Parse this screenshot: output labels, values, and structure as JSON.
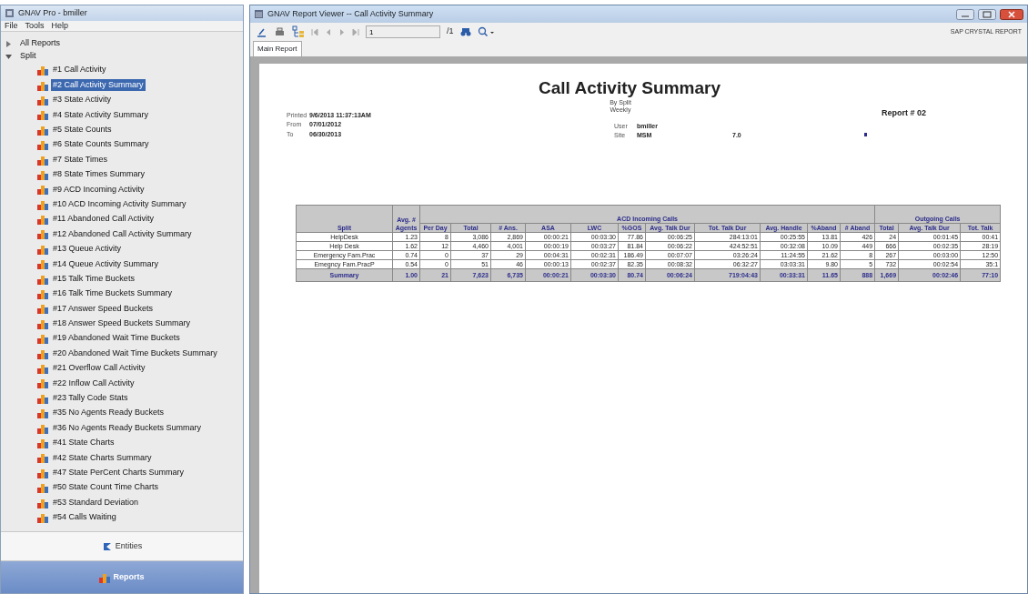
{
  "left_window": {
    "title": "GNAV Pro - bmiller",
    "menu": [
      "File",
      "Tools",
      "Help"
    ],
    "tree": [
      {
        "label": "All Reports",
        "expanded": false
      },
      {
        "label": "Split",
        "expanded": true,
        "children": [
          {
            "label": "#1 Call Activity",
            "selected": false
          },
          {
            "label": "#2 Call Activity Summary",
            "selected": true
          },
          {
            "label": "#3 State Activity",
            "selected": false
          },
          {
            "label": "#4 State Activity Summary",
            "selected": false
          },
          {
            "label": "#5 State Counts",
            "selected": false
          },
          {
            "label": "#6 State Counts Summary",
            "selected": false
          },
          {
            "label": "#7 State Times",
            "selected": false
          },
          {
            "label": "#8 State Times Summary",
            "selected": false
          },
          {
            "label": "#9 ACD Incoming Activity",
            "selected": false
          },
          {
            "label": "#10 ACD Incoming Activity Summary",
            "selected": false
          },
          {
            "label": "#11 Abandoned Call Activity",
            "selected": false
          },
          {
            "label": "#12 Abandoned Call Activity Summary",
            "selected": false
          },
          {
            "label": "#13 Queue Activity",
            "selected": false
          },
          {
            "label": "#14 Queue Activity Summary",
            "selected": false
          },
          {
            "label": "#15 Talk Time Buckets",
            "selected": false
          },
          {
            "label": "#16 Talk Time Buckets Summary",
            "selected": false
          },
          {
            "label": "#17 Answer Speed Buckets",
            "selected": false
          },
          {
            "label": "#18 Answer Speed Buckets Summary",
            "selected": false
          },
          {
            "label": "#19 Abandoned Wait Time Buckets",
            "selected": false
          },
          {
            "label": "#20 Abandoned Wait Time Buckets Summary",
            "selected": false
          },
          {
            "label": "#21 Overflow Call Activity",
            "selected": false
          },
          {
            "label": "#22 Inflow Call Activity",
            "selected": false
          },
          {
            "label": "#23 Tally Code Stats",
            "selected": false
          },
          {
            "label": "#35 No Agents Ready Buckets",
            "selected": false
          },
          {
            "label": "#36 No Agents Ready Buckets Summary",
            "selected": false
          },
          {
            "label": "#41 State Charts",
            "selected": false
          },
          {
            "label": "#42 State Charts Summary",
            "selected": false
          },
          {
            "label": "#47 State PerCent Charts Summary",
            "selected": false
          },
          {
            "label": "#50 State Count Time Charts",
            "selected": false
          },
          {
            "label": "#53 Standard Deviation",
            "selected": false
          },
          {
            "label": "#54 Calls Waiting",
            "selected": false
          }
        ]
      }
    ],
    "nav_buttons": [
      {
        "label": "Entities",
        "kind": "entities",
        "selected": false
      },
      {
        "label": "Reports",
        "kind": "reports",
        "selected": true
      }
    ]
  },
  "viewer": {
    "title": "GNAV Report Viewer -- Call Activity Summary",
    "page_field": "1",
    "page_count": "/1",
    "brand": "SAP CRYSTAL REPORT",
    "tabs": [
      {
        "label": "Main Report",
        "selected": true
      }
    ],
    "report": {
      "title": "Call Activity Summary",
      "subtitle": [
        "By Split",
        "Weekly"
      ],
      "report_number": "Report # 02",
      "left_fields": [
        {
          "label": "Printed",
          "value": "9/6/2013 11:37:13AM"
        },
        {
          "label": "From",
          "value": "07/01/2012"
        },
        {
          "label": "To",
          "value": "06/30/2013"
        }
      ],
      "right_fields": [
        {
          "label": "User",
          "value": "bmiller"
        },
        {
          "label": "Site",
          "value": "MSM",
          "extra": "7.0"
        }
      ],
      "table": {
        "columns": [
          "Split",
          "Avg. # Agents"
        ],
        "groups": [
          {
            "label": "ACD Incoming Calls",
            "columns": [
              "Per Day",
              "Total",
              "# Ans.",
              "ASA",
              "LWC",
              "%GOS",
              "Avg. Talk Dur",
              "Tot. Talk Dur",
              "Avg. Handle",
              "%Aband",
              "# Aband"
            ]
          },
          {
            "label": "Outgoing Calls",
            "columns": [
              "Total",
              "Avg. Talk Dur",
              "Tot. Talk"
            ]
          }
        ],
        "rows": [
          {
            "kind": "data",
            "cells": [
              "HelpDesk",
              "1.23",
              "8",
              "3,086",
              "2,869",
              "00:00:21",
              "00:03:30",
              "77.86",
              "00:06:25",
              "284:13:01",
              "00:25:55",
              "13.81",
              "426",
              "24",
              "00:01:45",
              "00:41"
            ]
          },
          {
            "kind": "data",
            "cells": [
              "Help Desk",
              "1.62",
              "12",
              "4,460",
              "4,001",
              "00:00:19",
              "00:03:27",
              "81.84",
              "00:06:22",
              "424:52:51",
              "00:32:08",
              "10.09",
              "449",
              "666",
              "00:02:35",
              "28:19"
            ]
          },
          {
            "kind": "data",
            "cells": [
              "Emergency Fam.Prac",
              "0.74",
              "0",
              "37",
              "29",
              "00:04:31",
              "00:02:31",
              "186.49",
              "00:07:07",
              "03:26:24",
              "11:24:55",
              "21.62",
              "8",
              "267",
              "00:03:00",
              "12:50"
            ]
          },
          {
            "kind": "data",
            "cells": [
              "Emegncy Fam.PracP",
              "0.54",
              "0",
              "51",
              "46",
              "00:00:13",
              "00:02:37",
              "82.35",
              "00:08:32",
              "06:32:27",
              "03:03:31",
              "9.80",
              "5",
              "732",
              "00:02:54",
              "35:1"
            ]
          },
          {
            "kind": "summary",
            "cells": [
              "Summary",
              "1.00",
              "21",
              "7,623",
              "6,735",
              "00:00:21",
              "00:03:30",
              "80.74",
              "00:06:24",
              "719:04:43",
              "00:33:31",
              "11.65",
              "888",
              "1,669",
              "00:02:46",
              "77:10"
            ]
          }
        ]
      }
    }
  }
}
